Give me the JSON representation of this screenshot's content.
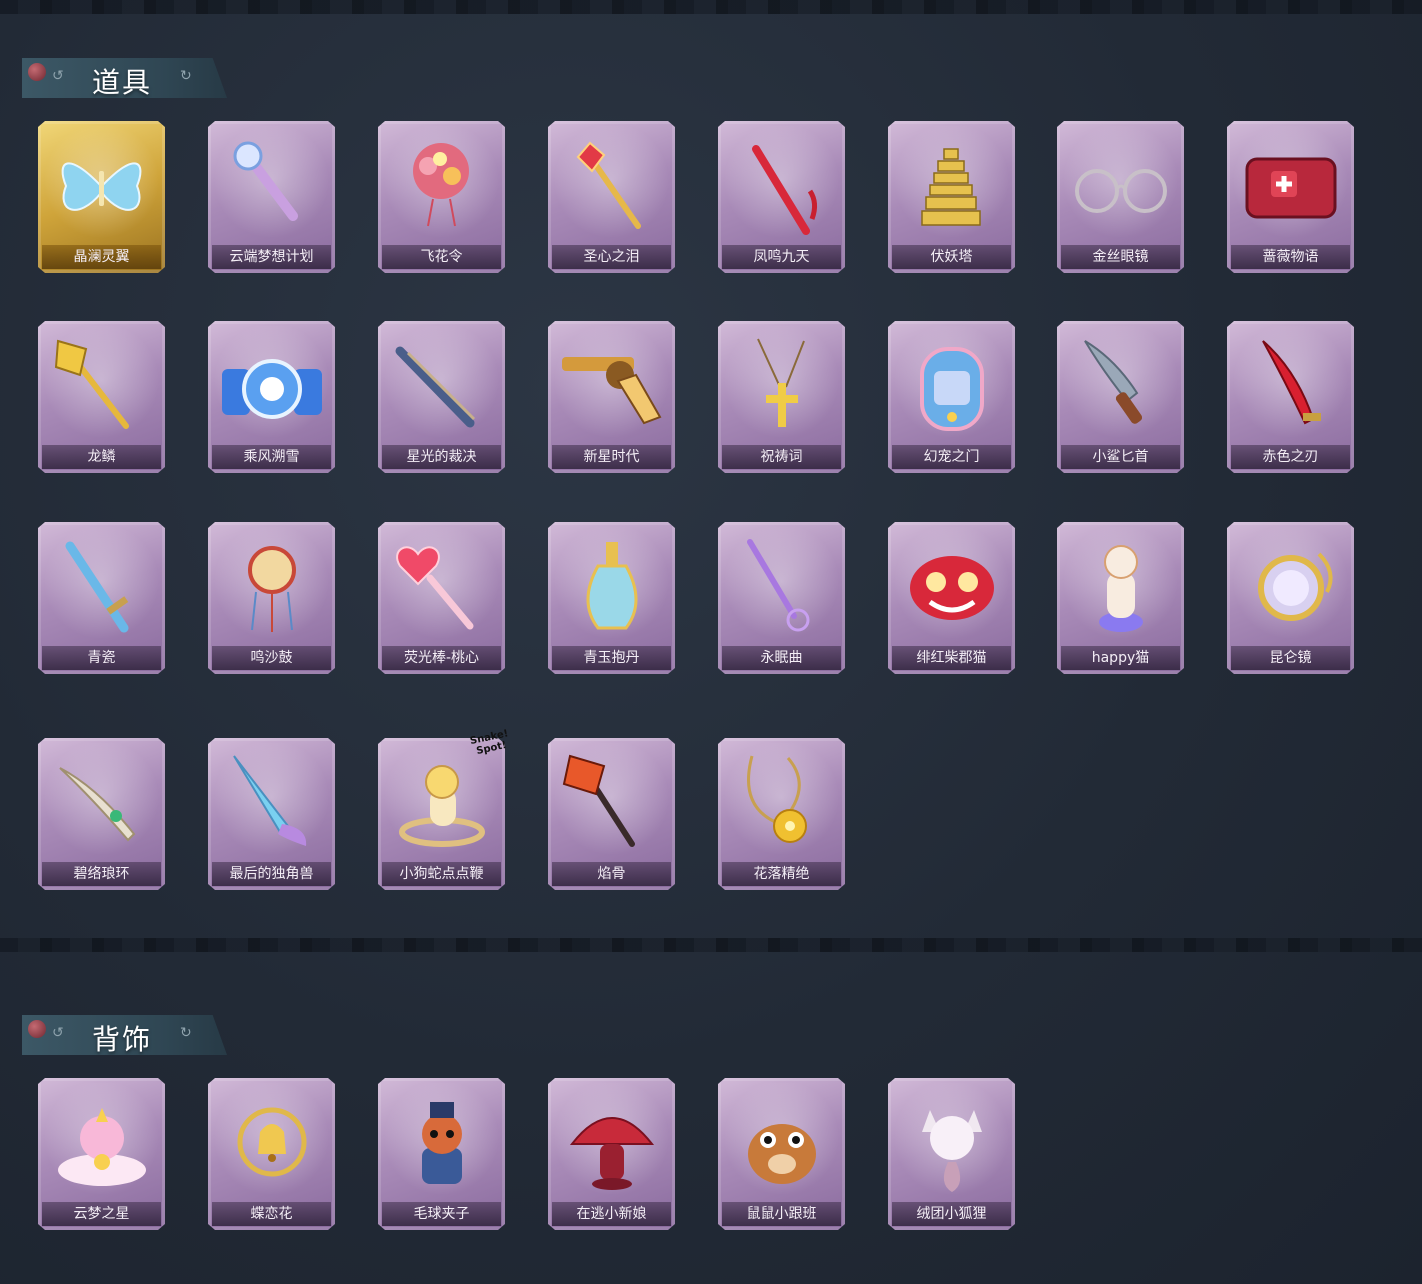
{
  "sections": [
    {
      "title": "道具",
      "items": [
        {
          "name": "晶澜灵翼",
          "icon": "butterfly-wings-icon",
          "rarity": "gold"
        },
        {
          "name": "云端梦想计划",
          "icon": "magic-wand-icon"
        },
        {
          "name": "飞花令",
          "icon": "flower-bouquet-icon"
        },
        {
          "name": "圣心之泪",
          "icon": "gem-scepter-icon"
        },
        {
          "name": "凤鸣九天",
          "icon": "red-sword-icon"
        },
        {
          "name": "伏妖塔",
          "icon": "pagoda-icon"
        },
        {
          "name": "金丝眼镜",
          "icon": "glasses-icon"
        },
        {
          "name": "蔷薇物语",
          "icon": "medkit-icon"
        },
        {
          "name": "龙鳞",
          "icon": "golden-shovel-icon"
        },
        {
          "name": "乘风溯雪",
          "icon": "snow-lanterns-icon"
        },
        {
          "name": "星光的裁决",
          "icon": "musket-icon"
        },
        {
          "name": "新星时代",
          "icon": "revolver-icon"
        },
        {
          "name": "祝祷词",
          "icon": "cross-necklace-icon"
        },
        {
          "name": "幻宠之门",
          "icon": "pet-device-icon"
        },
        {
          "name": "小鲨匕首",
          "icon": "shark-dagger-icon"
        },
        {
          "name": "赤色之刃",
          "icon": "red-blade-icon"
        },
        {
          "name": "青瓷",
          "icon": "celadon-sword-icon"
        },
        {
          "name": "鸣沙鼓",
          "icon": "sand-drum-icon"
        },
        {
          "name": "荧光棒-桃心",
          "icon": "heart-wand-icon"
        },
        {
          "name": "青玉抱丹",
          "icon": "jade-vase-icon"
        },
        {
          "name": "永眠曲",
          "icon": "rapier-icon"
        },
        {
          "name": "绯红柴郡猫",
          "icon": "cheshire-cat-icon"
        },
        {
          "name": "happy猫",
          "icon": "happy-cat-icon"
        },
        {
          "name": "昆仑镜",
          "icon": "ornate-mirror-icon"
        },
        {
          "name": "碧络琅环",
          "icon": "jade-blade-icon"
        },
        {
          "name": "最后的独角兽",
          "icon": "unicorn-lance-icon"
        },
        {
          "name": "小狗蛇点点鞭",
          "icon": "snake-whip-icon",
          "badge": "Snake! Spot!"
        },
        {
          "name": "焰骨",
          "icon": "flame-shovel-icon"
        },
        {
          "name": "花落精绝",
          "icon": "flower-chain-icon"
        }
      ]
    },
    {
      "title": "背饰",
      "items": [
        {
          "name": "云梦之星",
          "icon": "unicorn-cloud-icon"
        },
        {
          "name": "蝶恋花",
          "icon": "bell-wreath-icon"
        },
        {
          "name": "毛球夹子",
          "icon": "raccoon-soldier-icon"
        },
        {
          "name": "在逃小新娘",
          "icon": "mushroom-bride-icon"
        },
        {
          "name": "鼠鼠小跟班",
          "icon": "hamster-icon"
        },
        {
          "name": "绒团小狐狸",
          "icon": "fox-icon"
        }
      ]
    }
  ],
  "colors": {
    "background": "#222a36",
    "card_purple": "#a98bb8",
    "card_gold": "#cfa43a",
    "header": "#2f4653"
  }
}
